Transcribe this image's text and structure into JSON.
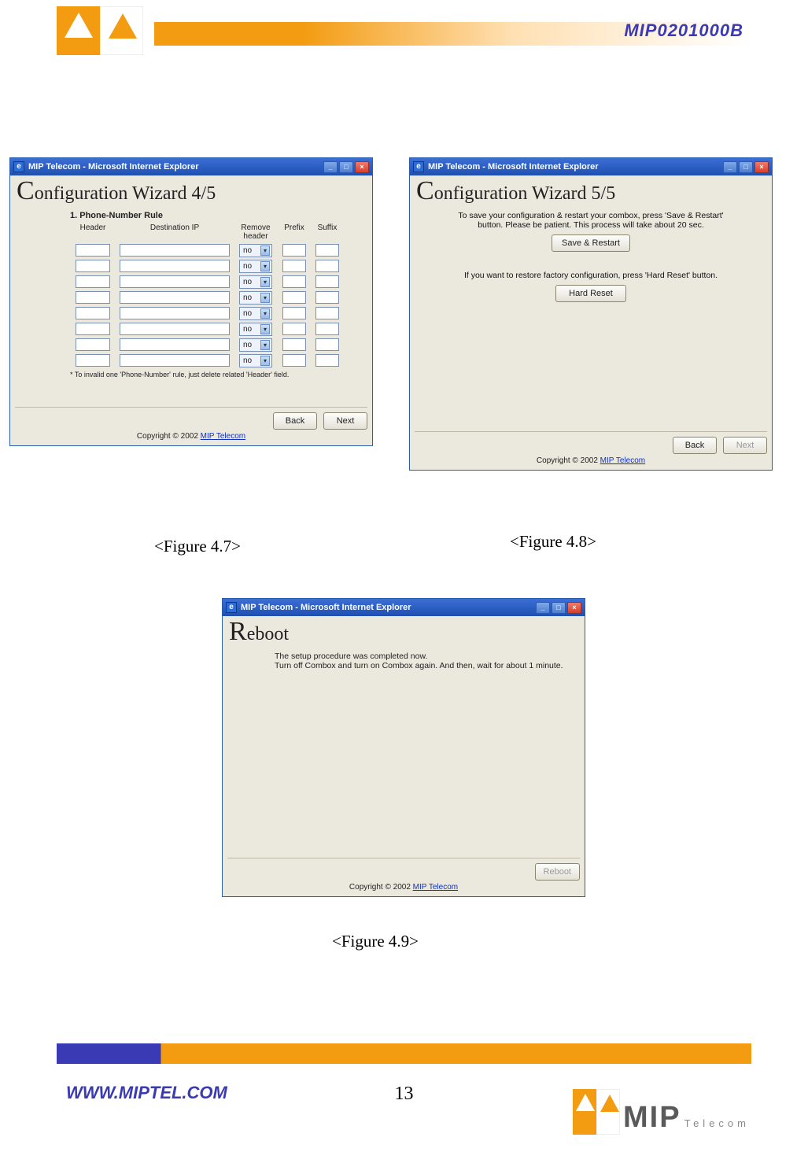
{
  "header": {
    "doc_code": "MIP0201000B"
  },
  "fig47": {
    "window_title": "MIP Telecom - Microsoft Internet Explorer",
    "page_title": "Configuration Wizard 4/5",
    "section_title": "1. Phone-Number Rule",
    "columns": {
      "header": "Header",
      "dest_ip": "Destination IP",
      "remove_header": "Remove header",
      "prefix": "Prefix",
      "suffix": "Suffix"
    },
    "select_value": "no",
    "row_count": 8,
    "footnote": "* To invalid one 'Phone-Number' rule, just delete related 'Header' field.",
    "back": "Back",
    "next": "Next",
    "copyright_prefix": "Copyright © 2002 ",
    "copyright_link": "MIP Telecom",
    "caption": "<Figure 4.7>"
  },
  "fig48": {
    "window_title": "MIP Telecom - Microsoft Internet Explorer",
    "page_title": "Configuration Wizard 5/5",
    "msg1": "To save your configuration & restart your combox, press 'Save & Restart' button. Please be patient. This process will take about 20 sec.",
    "btn1": "Save & Restart",
    "msg2": "If you want to restore factory configuration, press 'Hard Reset' button.",
    "btn2": "Hard Reset",
    "back": "Back",
    "next": "Next",
    "copyright_prefix": "Copyright © 2002 ",
    "copyright_link": "MIP Telecom",
    "caption": "<Figure 4.8>"
  },
  "fig49": {
    "window_title": "MIP Telecom - Microsoft Internet Explorer",
    "page_title": "Reboot",
    "line1": "The setup procedure was completed now.",
    "line2": "Turn off Combox and turn on Combox again. And then, wait for about 1 minute.",
    "reboot": "Reboot",
    "copyright_prefix": "Copyright © 2002 ",
    "copyright_link": "MIP Telecom",
    "caption": "<Figure 4.9>"
  },
  "footer": {
    "url": "WWW.MIPTEL.COM",
    "page_number": "13",
    "logo_text": "MIP",
    "logo_sub": "Telecom"
  }
}
